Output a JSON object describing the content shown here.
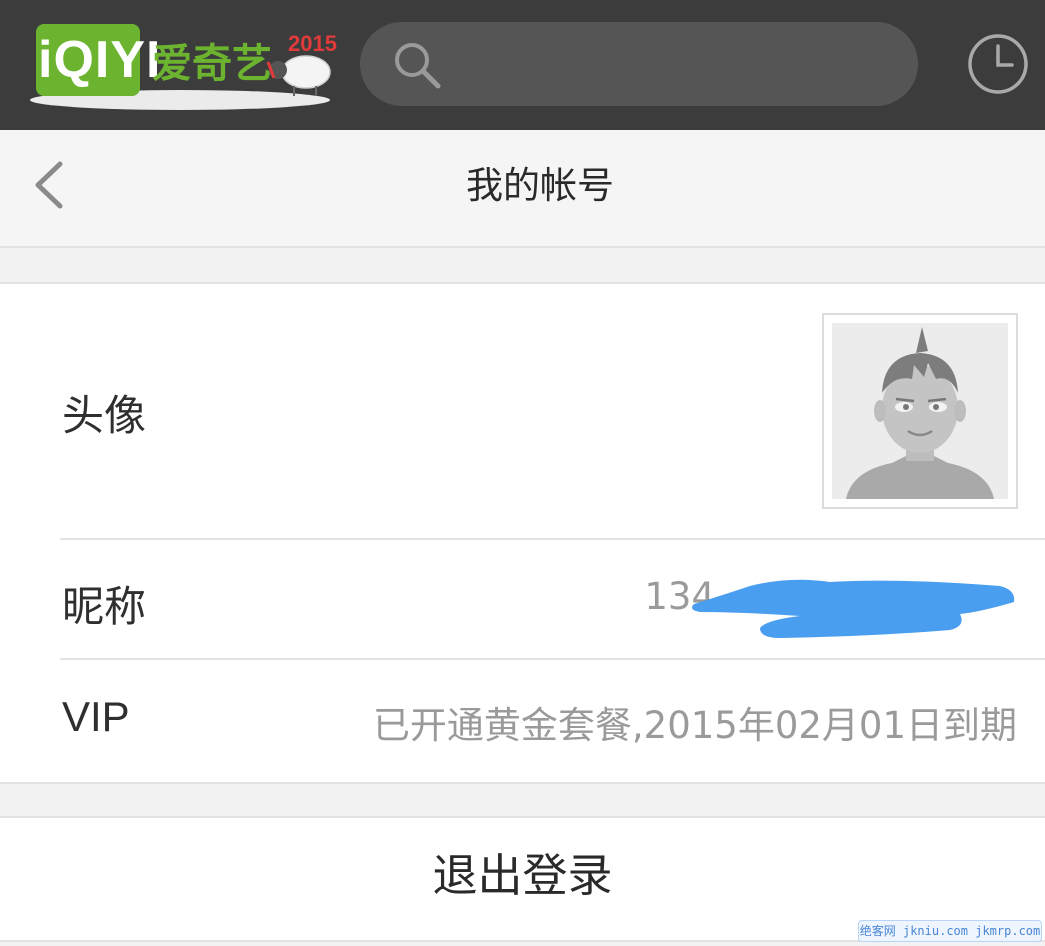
{
  "app": {
    "logo_text": "iQIYI",
    "logo_cn": "爱奇艺",
    "logo_year": "2015",
    "brand_color": "#6cb42f"
  },
  "topbar": {
    "background": "#3c3c3c",
    "search": {
      "placeholder": "",
      "value": ""
    },
    "icons": [
      "search-icon",
      "history-clock-icon"
    ]
  },
  "header": {
    "title": "我的帐号",
    "back_icon": "chevron-left-icon"
  },
  "account": {
    "avatar": {
      "label": "头像"
    },
    "nickname": {
      "label": "昵称",
      "value_visible": "134",
      "redacted": true
    },
    "vip": {
      "label": "VIP",
      "value": "已开通黄金套餐,2015年02月01日到期"
    }
  },
  "actions": {
    "logout": "退出登录"
  },
  "watermark": "绝客网 jkniu.com jkmrp.com"
}
